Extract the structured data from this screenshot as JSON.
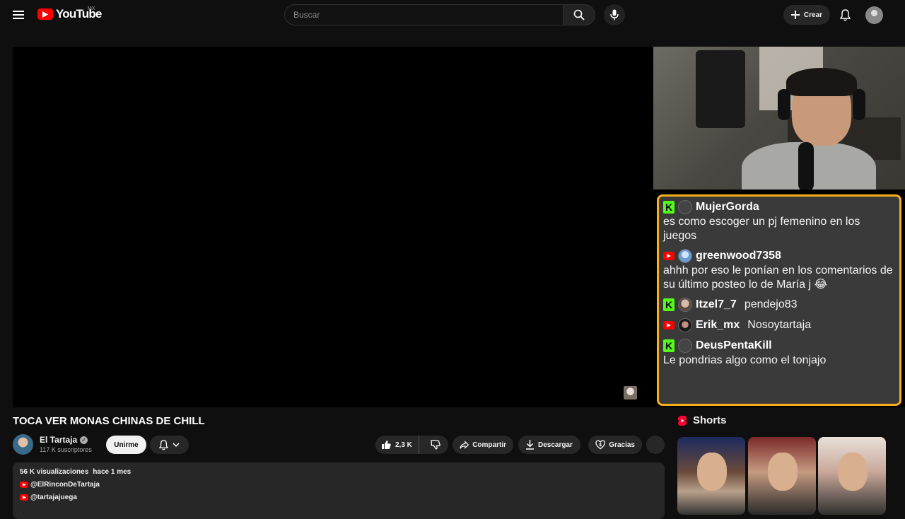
{
  "header": {
    "logo_text": "YouTube",
    "country_code": "MX",
    "search_placeholder": "Buscar",
    "create_label": "Crear"
  },
  "video": {
    "title": "TOCA VER MONAS CHINAS DE CHILL",
    "channel_name": "El Tartaja",
    "subscribers": "117 K suscriptores",
    "join_label": "Unirme",
    "likes": "2,3 K",
    "share_label": "Compartir",
    "download_label": "Descargar",
    "thanks_label": "Gracias"
  },
  "description": {
    "views": "56 K visualizaciones",
    "date": "hace 1 mes",
    "links": [
      "@ElRinconDeTartaja",
      "@tartajajuega"
    ]
  },
  "chat": {
    "messages": [
      {
        "platform": "kick",
        "avatar": "default",
        "user": "MujerGorda",
        "text": "es como escoger un pj femenino en los juegos",
        "inline": false
      },
      {
        "platform": "youtube",
        "avatar": "blue",
        "user": "greenwood7358",
        "text": "ahhh por eso le ponían en los comentarios de su último posteo lo de María j 😂",
        "inline": false
      },
      {
        "platform": "kick",
        "avatar": "face",
        "user": "Itzel7_7",
        "text": "pendejo83",
        "inline": true
      },
      {
        "platform": "youtube",
        "avatar": "dark",
        "user": "Erik_mx",
        "text": "Nosoytartaja",
        "inline": true
      },
      {
        "platform": "kick",
        "avatar": "default",
        "user": "DeusPentaKill",
        "text": "Le pondrias algo como el tonjajo",
        "inline": false
      }
    ]
  },
  "shorts": {
    "title": "Shorts"
  },
  "colors": {
    "background": "#0f0f0f",
    "youtube_red": "#ff0000",
    "kick_green": "#53fc18",
    "chat_border": "#f6b01e"
  }
}
